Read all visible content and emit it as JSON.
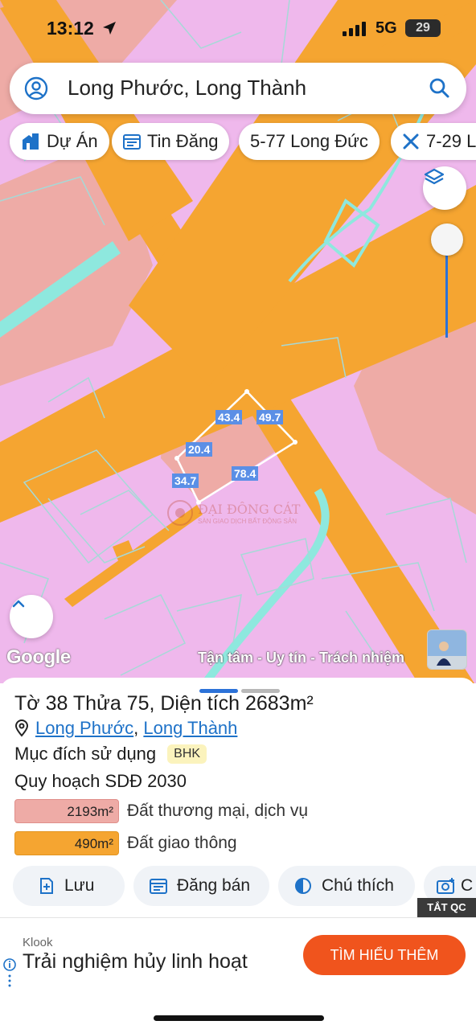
{
  "status_bar": {
    "time": "13:12",
    "network": "5G",
    "battery": "29"
  },
  "search": {
    "text": "Long Phước, Long Thành",
    "user_icon": "user-circle-icon",
    "search_icon": "search-icon"
  },
  "chips": [
    {
      "label": "Dự Án",
      "icon": "building-icon"
    },
    {
      "label": "Tin Đăng",
      "icon": "calendar-list-icon"
    },
    {
      "label": "5-77 Long Đức",
      "icon": ""
    },
    {
      "label": "7-29 L",
      "icon": "ruler-cross-icon"
    }
  ],
  "map": {
    "colors": {
      "residential": "#efb8ec",
      "commercial": "#eeaba6",
      "road": "#f5a531",
      "water": "#8ee8de",
      "boundary": "#a6d9d7",
      "selection": "#ffffff"
    },
    "dimension_labels": [
      "43.4",
      "49.7",
      "20.4",
      "78.4",
      "34.7"
    ],
    "watermark_title": "ĐẠI ĐÔNG CÁT",
    "watermark_sub": "SÀN GIAO DỊCH BẤT ĐỘNG SẢN",
    "google": "Google",
    "tagline": "Tận tâm - Uy tín - Trách nhiệm"
  },
  "parcel": {
    "title": "Tờ 38 Thửa 75, Diện tích 2683m²",
    "ward": "Long Phước",
    "separator": ", ",
    "district": "Long Thành",
    "purpose_label": "Mục đích sử dụng",
    "purpose_code": "BHK",
    "plan_label": "Quy hoạch SDĐ 2030",
    "legend": [
      {
        "area": "2193m²",
        "label": "Đất thương mại, dịch vụ",
        "color": "#eeaba6"
      },
      {
        "area": "490m²",
        "label": "Đất giao thông",
        "color": "#f5a531"
      }
    ]
  },
  "actions": [
    {
      "label": "Lưu",
      "icon": "bookmark-plus-icon"
    },
    {
      "label": "Đăng bán",
      "icon": "calendar-list-icon"
    },
    {
      "label": "Chú thích",
      "icon": "half-circle-icon"
    },
    {
      "label": "C",
      "icon": "camera-plus-icon"
    }
  ],
  "ad": {
    "close_label": "TẮT QC",
    "brand": "Klook",
    "text": "Trải nghiệm hủy linh hoạt",
    "cta": "TÌM HIỂU THÊM"
  }
}
